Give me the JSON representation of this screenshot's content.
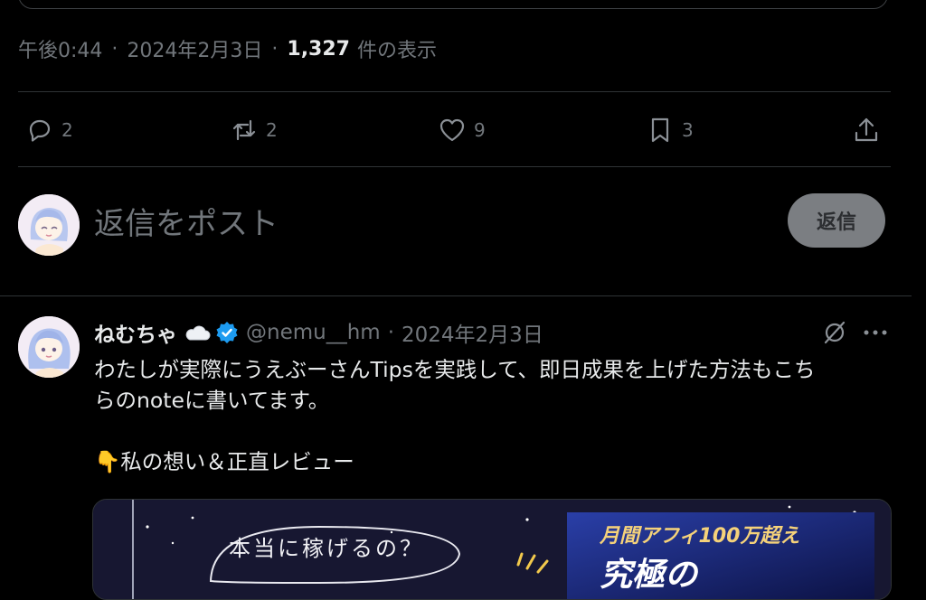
{
  "tweet_meta": {
    "time": "午後0:44",
    "sep": "·",
    "date": "2024年2月3日",
    "views_count": "1,327",
    "views_label": "件の表示"
  },
  "actions": {
    "replies": "2",
    "reposts": "2",
    "likes": "9",
    "bookmarks": "3"
  },
  "compose": {
    "placeholder": "返信をポスト",
    "reply_button": "返信"
  },
  "reply_post": {
    "author_name": "ねむちゃ",
    "handle": "@nemu__hm",
    "sep": "·",
    "date": "2024年2月3日",
    "text_line1": "わたしが実際にうえぶーさんTipsを実践して、即日成果を上げた方法もこち",
    "text_line2": "らのnoteに書いてます。",
    "text_line3": "👇私の想い＆正直レビュー",
    "media_text_left": "本当に稼げるの？",
    "media_text_right": "月間アフィ100万超え",
    "media_text_right2": "究極の"
  }
}
